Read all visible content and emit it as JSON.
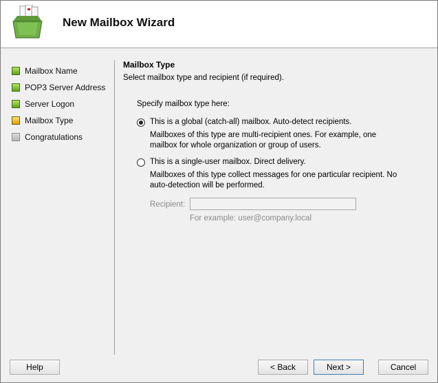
{
  "window": {
    "title": "New Mailbox Wizard"
  },
  "steps": [
    {
      "label": "Mailbox Name",
      "state": "done"
    },
    {
      "label": "POP3 Server Address",
      "state": "done"
    },
    {
      "label": "Server Logon",
      "state": "done"
    },
    {
      "label": "Mailbox Type",
      "state": "current"
    },
    {
      "label": "Congratulations",
      "state": "pending"
    }
  ],
  "content": {
    "section_title": "Mailbox Type",
    "section_subtitle": "Select mailbox type and recipient (if required).",
    "specify_label": "Specify mailbox type here:",
    "options": [
      {
        "label": "This is a global (catch-all) mailbox. Auto-detect recipients.",
        "checked": true,
        "description": "Mailboxes of this type are multi-recipient ones. For example, one mailbox for whole organization or group of users."
      },
      {
        "label": "This is a single-user mailbox. Direct delivery.",
        "checked": false,
        "description": "Mailboxes of this type collect messages for one particular recipient. No auto-detection will be performed."
      }
    ],
    "recipient": {
      "label": "Recipient:",
      "value": "",
      "hint": "For example: user@company.local",
      "enabled": false
    }
  },
  "buttons": {
    "help": "Help",
    "back": "< Back",
    "next": "Next >",
    "cancel": "Cancel"
  },
  "colors": {
    "step_done": "#6bb022",
    "step_current": "#e0a800",
    "step_pending": "#b8b8b8"
  }
}
